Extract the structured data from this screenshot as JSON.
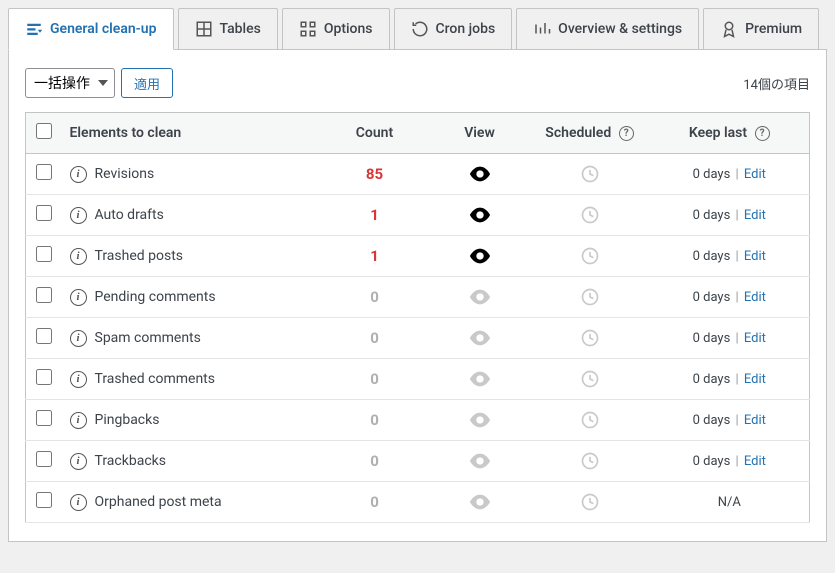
{
  "tabs": [
    {
      "label": "General clean-up",
      "active": true,
      "icon": "cleanup"
    },
    {
      "label": "Tables",
      "active": false,
      "icon": "tables"
    },
    {
      "label": "Options",
      "active": false,
      "icon": "options"
    },
    {
      "label": "Cron jobs",
      "active": false,
      "icon": "cron"
    },
    {
      "label": "Overview & settings",
      "active": false,
      "icon": "overview"
    },
    {
      "label": "Premium",
      "active": false,
      "icon": "premium"
    }
  ],
  "bulk": {
    "select_label": "一括操作",
    "apply_label": "適用"
  },
  "items_count_label": "14個の項目",
  "columns": {
    "elements": "Elements to clean",
    "count": "Count",
    "view": "View",
    "scheduled": "Scheduled",
    "keep_last": "Keep last"
  },
  "rows": [
    {
      "name": "Revisions",
      "count": 85,
      "nonzero": true,
      "keep": "0 days",
      "edit": "Edit"
    },
    {
      "name": "Auto drafts",
      "count": 1,
      "nonzero": true,
      "keep": "0 days",
      "edit": "Edit"
    },
    {
      "name": "Trashed posts",
      "count": 1,
      "nonzero": true,
      "keep": "0 days",
      "edit": "Edit"
    },
    {
      "name": "Pending comments",
      "count": 0,
      "nonzero": false,
      "keep": "0 days",
      "edit": "Edit"
    },
    {
      "name": "Spam comments",
      "count": 0,
      "nonzero": false,
      "keep": "0 days",
      "edit": "Edit"
    },
    {
      "name": "Trashed comments",
      "count": 0,
      "nonzero": false,
      "keep": "0 days",
      "edit": "Edit"
    },
    {
      "name": "Pingbacks",
      "count": 0,
      "nonzero": false,
      "keep": "0 days",
      "edit": "Edit"
    },
    {
      "name": "Trackbacks",
      "count": 0,
      "nonzero": false,
      "keep": "0 days",
      "edit": "Edit"
    },
    {
      "name": "Orphaned post meta",
      "count": 0,
      "nonzero": false,
      "keep": "N/A",
      "edit": null
    }
  ]
}
